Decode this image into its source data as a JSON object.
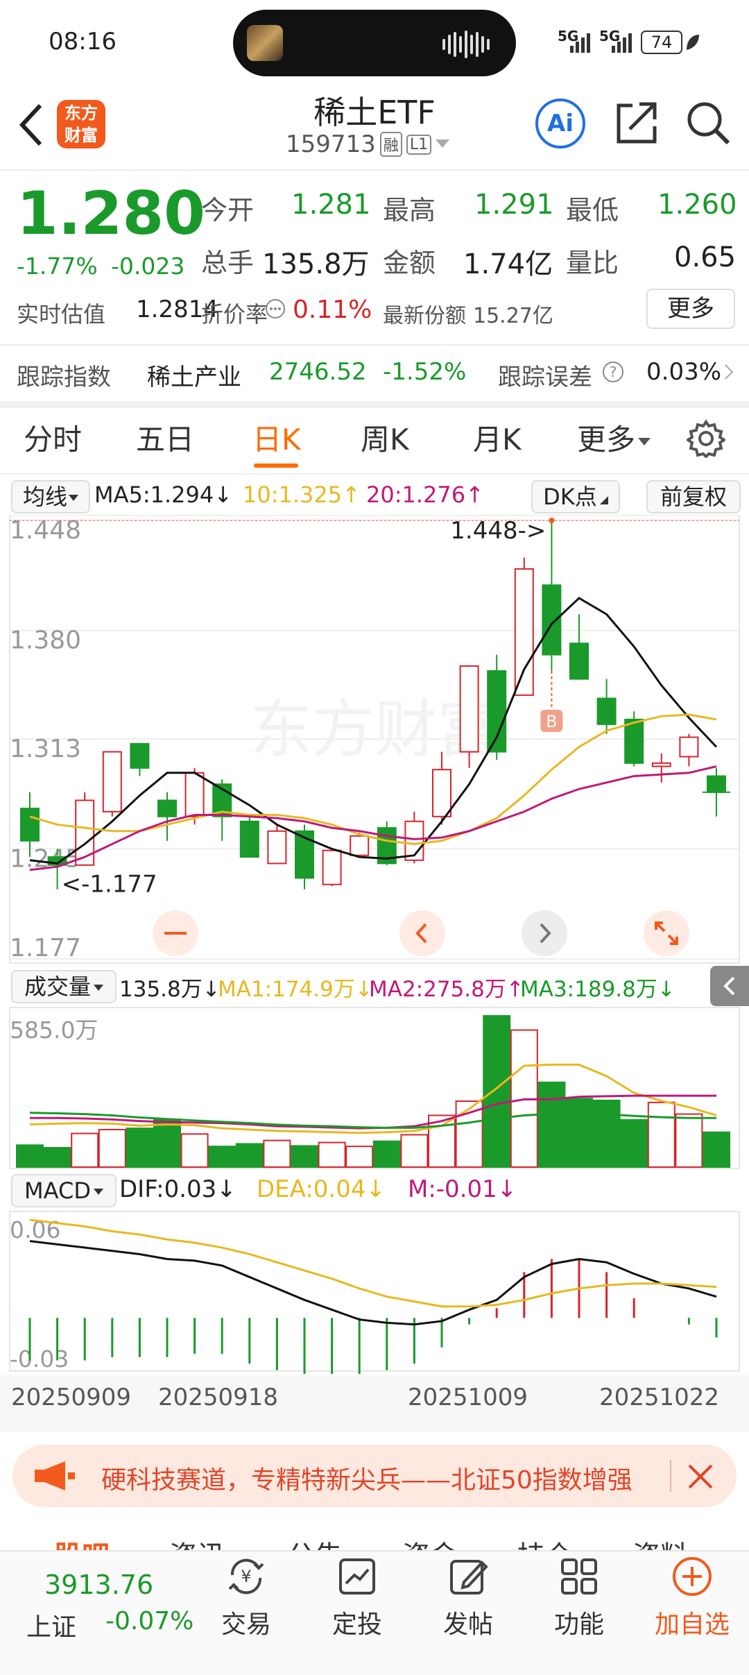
{
  "status": {
    "time": "08:16",
    "battery": "74",
    "signal1": "5G",
    "signal2": "5G"
  },
  "header": {
    "title": "稀土ETF",
    "code": "159713",
    "tag_rong": "融",
    "tag_level": "L1",
    "logo_line1": "东方",
    "logo_line2": "财富",
    "ai_label": "Ai"
  },
  "quote": {
    "price": "1.280",
    "change_pct": "-1.77%",
    "change": "-0.023",
    "open_label": "今开",
    "open": "1.281",
    "high_label": "最高",
    "high": "1.291",
    "low_label": "最低",
    "low": "1.260",
    "volume_label": "总手",
    "volume": "135.8万",
    "amount_label": "金额",
    "amount": "1.74亿",
    "ratio_label": "量比",
    "ratio": "0.65",
    "iopv_label": "实时估值",
    "iopv": "1.2814",
    "premium_label": "折价率",
    "premium": "0.11%",
    "shares_label": "最新份额",
    "shares": "15.27亿",
    "more_button": "更多"
  },
  "tracking": {
    "label": "跟踪指数",
    "index_name": "稀土产业",
    "index_value": "2746.52",
    "index_change": "-1.52%",
    "error_label": "跟踪误差",
    "error_value": "0.03%"
  },
  "tabs": [
    "分时",
    "五日",
    "日K",
    "周K",
    "月K",
    "更多"
  ],
  "active_tab": "日K",
  "ma_bar": {
    "select": "均线",
    "ma5": "MA5:1.294↓",
    "ma10": "10:1.325↑",
    "ma20": "20:1.276↑",
    "dk": "DK点",
    "adjust": "前复权"
  },
  "price_axis": [
    "1.448",
    "1.380",
    "1.313",
    "1.245",
    "1.177"
  ],
  "annotations": {
    "high": "1.448->",
    "low": "<-1.177",
    "b_marker": "B"
  },
  "watermark": "东方财富",
  "volume_bar": {
    "select": "成交量",
    "value": "135.8万↓",
    "ma1": "MA1:174.9万↓",
    "ma2": "MA2:275.8万↑",
    "ma3": "MA3:189.8万↓",
    "axis_max": "585.0万"
  },
  "macd_bar": {
    "select": "MACD",
    "dif": "DIF:0.03↓",
    "dea": "DEA:0.04↓",
    "m": "M:-0.01↓",
    "axis_top": "0.06",
    "axis_bottom": "-0.03"
  },
  "dates": [
    "20250909",
    "20250918",
    "20251009",
    "20251022"
  ],
  "banner": {
    "text": "硬科技赛道，专精特新尖兵——北证50指数增强"
  },
  "section_tabs": [
    "股吧",
    "资讯",
    "公告",
    "资金",
    "持仓",
    "资料"
  ],
  "bottom_nav": {
    "index_value": "3913.76",
    "index_name": "上证",
    "index_change": "-0.07%",
    "items": [
      "交易",
      "定投",
      "发帖",
      "功能",
      "加自选"
    ]
  },
  "colors": {
    "up": "#d8232a",
    "down": "#1a9a2a",
    "ma5": "#111111",
    "ma10": "#e8b820",
    "ma20": "#c0187a",
    "accent": "#ff6a00"
  },
  "chart_data": {
    "type": "candlestick",
    "y_range": [
      1.177,
      1.448
    ],
    "candles": [
      {
        "o": 1.27,
        "c": 1.25,
        "h": 1.28,
        "l": 1.24
      },
      {
        "o": 1.24,
        "c": 1.235,
        "h": 1.245,
        "l": 1.22
      },
      {
        "o": 1.235,
        "c": 1.275,
        "h": 1.28,
        "l": 1.235
      },
      {
        "o": 1.268,
        "c": 1.305,
        "h": 1.305,
        "l": 1.265
      },
      {
        "o": 1.31,
        "c": 1.295,
        "h": 1.31,
        "l": 1.29
      },
      {
        "o": 1.275,
        "c": 1.265,
        "h": 1.28,
        "l": 1.25
      },
      {
        "o": 1.265,
        "c": 1.292,
        "h": 1.295,
        "l": 1.26
      },
      {
        "o": 1.285,
        "c": 1.265,
        "h": 1.288,
        "l": 1.25
      },
      {
        "o": 1.262,
        "c": 1.24,
        "h": 1.265,
        "l": 1.24
      },
      {
        "o": 1.236,
        "c": 1.256,
        "h": 1.26,
        "l": 1.236
      },
      {
        "o": 1.256,
        "c": 1.227,
        "h": 1.26,
        "l": 1.22
      },
      {
        "o": 1.223,
        "c": 1.244,
        "h": 1.245,
        "l": 1.222
      },
      {
        "o": 1.241,
        "c": 1.253,
        "h": 1.255,
        "l": 1.24
      },
      {
        "o": 1.258,
        "c": 1.236,
        "h": 1.262,
        "l": 1.235
      },
      {
        "o": 1.238,
        "c": 1.262,
        "h": 1.268,
        "l": 1.236
      },
      {
        "o": 1.265,
        "c": 1.294,
        "h": 1.305,
        "l": 1.26
      },
      {
        "o": 1.305,
        "c": 1.358,
        "h": 1.358,
        "l": 1.295
      },
      {
        "o": 1.355,
        "c": 1.305,
        "h": 1.365,
        "l": 1.3
      },
      {
        "o": 1.34,
        "c": 1.418,
        "h": 1.425,
        "l": 1.34
      },
      {
        "o": 1.408,
        "c": 1.365,
        "h": 1.448,
        "l": 1.355
      },
      {
        "o": 1.372,
        "c": 1.35,
        "h": 1.39,
        "l": 1.35
      },
      {
        "o": 1.338,
        "c": 1.322,
        "h": 1.35,
        "l": 1.316
      },
      {
        "o": 1.325,
        "c": 1.298,
        "h": 1.33,
        "l": 1.296
      },
      {
        "o": 1.296,
        "c": 1.298,
        "h": 1.304,
        "l": 1.286
      },
      {
        "o": 1.302,
        "c": 1.314,
        "h": 1.316,
        "l": 1.296
      },
      {
        "o": 1.29,
        "c": 1.28,
        "h": 1.295,
        "l": 1.265
      }
    ],
    "ma5": [
      1.238,
      1.236,
      1.248,
      1.262,
      1.278,
      1.292,
      1.292,
      1.282,
      1.272,
      1.26,
      1.252,
      1.245,
      1.24,
      1.239,
      1.241,
      1.262,
      1.285,
      1.314,
      1.356,
      1.384,
      1.4,
      1.39,
      1.37,
      1.346,
      1.326,
      1.308
    ],
    "ma10": [
      1.265,
      1.26,
      1.258,
      1.256,
      1.256,
      1.26,
      1.264,
      1.268,
      1.266,
      1.266,
      1.264,
      1.26,
      1.254,
      1.25,
      1.248,
      1.25,
      1.256,
      1.264,
      1.278,
      1.294,
      1.308,
      1.318,
      1.323,
      1.327,
      1.328,
      1.325
    ],
    "ma20": [
      1.232,
      1.234,
      1.24,
      1.248,
      1.256,
      1.262,
      1.266,
      1.266,
      1.265,
      1.264,
      1.262,
      1.258,
      1.256,
      1.253,
      1.251,
      1.252,
      1.256,
      1.262,
      1.268,
      1.276,
      1.282,
      1.286,
      1.29,
      1.291,
      1.292,
      1.296
    ],
    "volumes": [
      85,
      75,
      130,
      145,
      150,
      185,
      128,
      80,
      90,
      103,
      82,
      95,
      80,
      100,
      125,
      200,
      255,
      585,
      530,
      328,
      265,
      258,
      183,
      250,
      205,
      135
    ],
    "vol_ma1": [
      165,
      168,
      170,
      168,
      160,
      165,
      162,
      150,
      145,
      140,
      138,
      135,
      132,
      135,
      140,
      160,
      225,
      305,
      392,
      396,
      396,
      352,
      287,
      256,
      232,
      200
    ],
    "vol_ma2": [
      190,
      190,
      188,
      184,
      178,
      174,
      172,
      170,
      165,
      158,
      156,
      153,
      150,
      152,
      158,
      178,
      210,
      244,
      262,
      262,
      272,
      274,
      276,
      276,
      276,
      276
    ],
    "vol_ma3": [
      210,
      208,
      205,
      200,
      192,
      186,
      180,
      175,
      170,
      164,
      160,
      158,
      154,
      152,
      152,
      160,
      172,
      188,
      200,
      206,
      208,
      204,
      198,
      193,
      190,
      190
    ],
    "dif": [
      0.047,
      0.045,
      0.043,
      0.041,
      0.039,
      0.036,
      0.035,
      0.032,
      0.025,
      0.018,
      0.011,
      0.005,
      -0.001,
      -0.003,
      -0.004,
      -0.002,
      0.005,
      0.011,
      0.025,
      0.033,
      0.036,
      0.034,
      0.027,
      0.021,
      0.018,
      0.013
    ],
    "dea": [
      0.06,
      0.058,
      0.056,
      0.053,
      0.051,
      0.048,
      0.046,
      0.043,
      0.039,
      0.034,
      0.029,
      0.024,
      0.018,
      0.013,
      0.01,
      0.007,
      0.007,
      0.008,
      0.011,
      0.015,
      0.018,
      0.02,
      0.021,
      0.021,
      0.02,
      0.019
    ],
    "macd_range": [
      -0.03,
      0.06
    ]
  }
}
